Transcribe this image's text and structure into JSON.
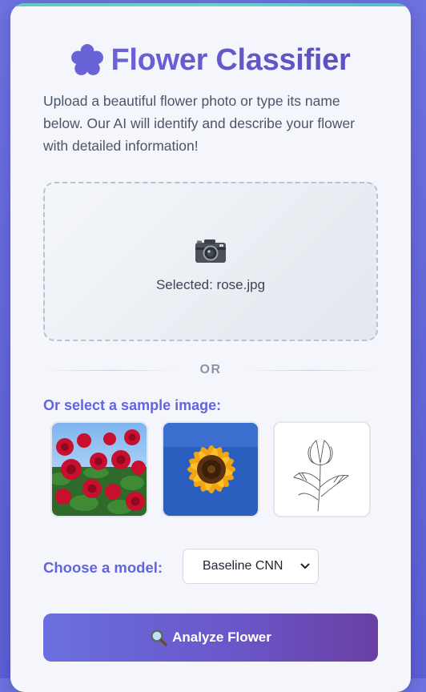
{
  "header": {
    "title": "Flower Classifier",
    "icon": "flower-icon",
    "accent_color": "#6a5fd6"
  },
  "intro": {
    "description": "Upload a beautiful flower photo or type its name below. Our AI will identify and describe your flower with detailed information!"
  },
  "upload": {
    "icon": "camera-icon",
    "selected_text": "Selected: rose.jpg"
  },
  "divider": {
    "text": "OR"
  },
  "samples": {
    "label": "Or select a sample image:",
    "images": [
      {
        "name": "rose-photo"
      },
      {
        "name": "sunflower-photo"
      },
      {
        "name": "tulip-sketch"
      }
    ]
  },
  "model": {
    "label": "Choose a model:",
    "selected": "Baseline CNN"
  },
  "actions": {
    "analyze_icon": "magnifier-icon",
    "analyze_label": "Analyze Flower"
  }
}
